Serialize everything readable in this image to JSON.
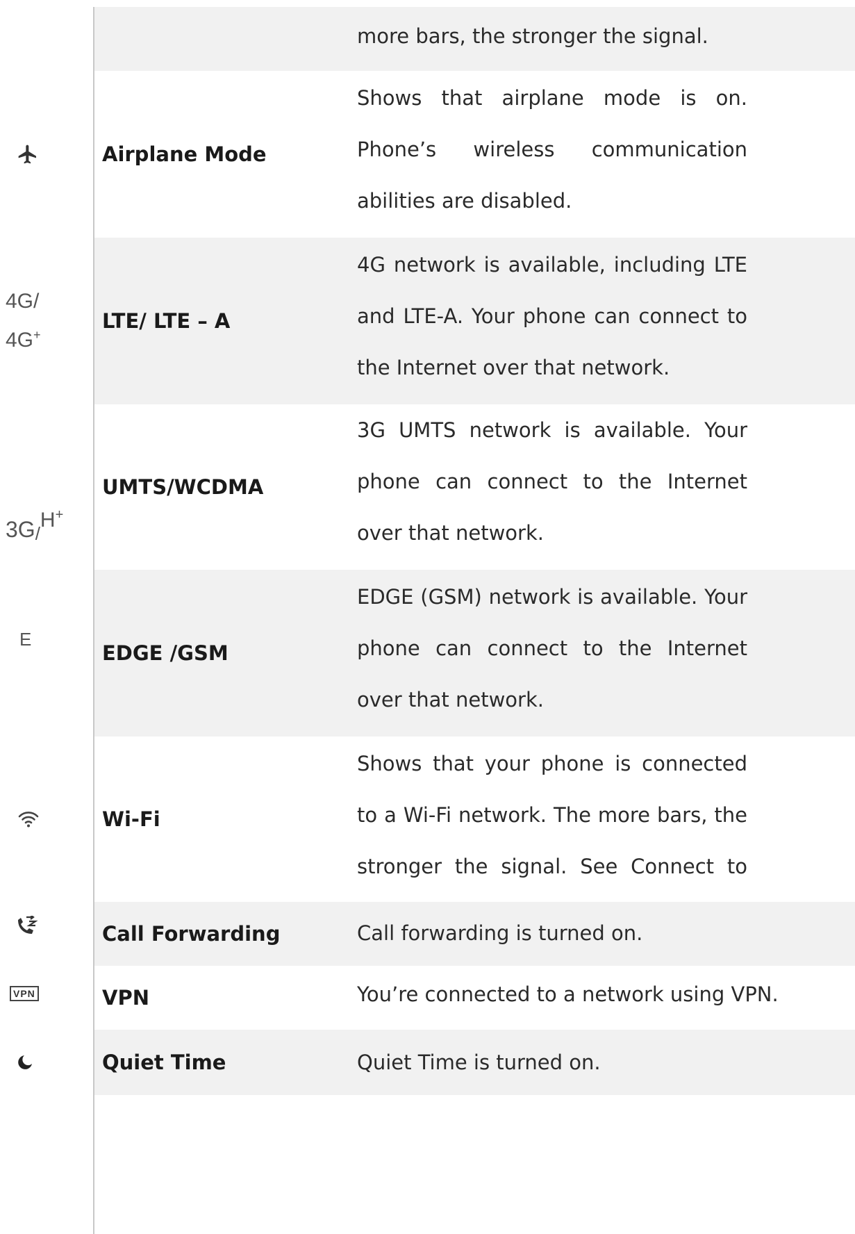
{
  "rows": [
    {
      "icon": "",
      "feature": "",
      "description": "more bars, the stronger the signal."
    },
    {
      "icon": "airplane-icon",
      "feature": "Airplane Mode",
      "description": "Shows that airplane mode is on. Phone’s wireless communication abilities are disabled."
    },
    {
      "icon": "4g-icon",
      "icon_text": "4G/",
      "icon_text_2": "4G",
      "icon_sup": "+",
      "feature": "LTE/ LTE – A",
      "description": "4G network is available, including LTE and LTE-A. Your phone can connect to the Internet over that network."
    },
    {
      "icon": "3g-icon",
      "icon_text": "3G",
      "icon_sep": "/",
      "icon_text_2": "H",
      "icon_sup": "+",
      "feature": "UMTS/WCDMA",
      "description": "3G UMTS network is available. Your phone can connect to the Internet over that network."
    },
    {
      "icon": "edge-icon",
      "icon_text": "E",
      "feature": "EDGE /GSM",
      "description": "EDGE (GSM) network is available. Your phone can connect to the Internet over that network."
    },
    {
      "icon": "wifi-icon",
      "feature": "Wi-Fi",
      "description": "Shows that your phone is connected to a Wi-Fi network. The more bars, the stronger the signal. See Connect to Wi-Fi."
    },
    {
      "icon": "call-forwarding-icon",
      "feature": "Call Forwarding",
      "description": "Call forwarding is turned on."
    },
    {
      "icon": "vpn-icon",
      "icon_text": "VPN",
      "feature": "VPN",
      "description": "You’re connected to a network using VPN."
    },
    {
      "icon": "moon-icon",
      "feature": "Quiet Time",
      "description": "Quiet Time is turned on."
    }
  ]
}
